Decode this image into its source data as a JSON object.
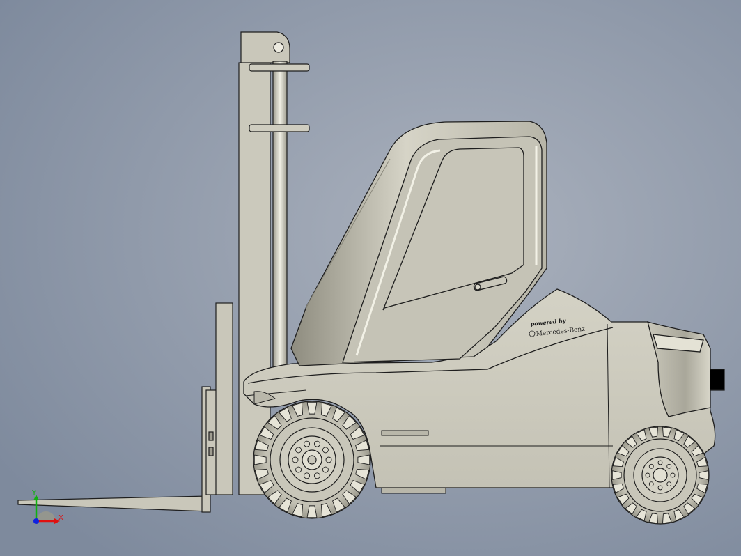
{
  "viewport": {
    "background_center": "#aab1bd",
    "background_edge": "#7e8a9d"
  },
  "model": {
    "body_color": "#c9c7ba",
    "edge_color": "#1e1e1e",
    "shadow_color": "#8f8d80",
    "highlight_color": "#ececdf"
  },
  "decal": {
    "line1": "powered by",
    "line2": "Mercedes-Benz"
  },
  "triad": {
    "x_label": "X",
    "y_label": "Y",
    "x_color": "#e01010",
    "y_color": "#10b010",
    "z_color": "#1020e0"
  }
}
